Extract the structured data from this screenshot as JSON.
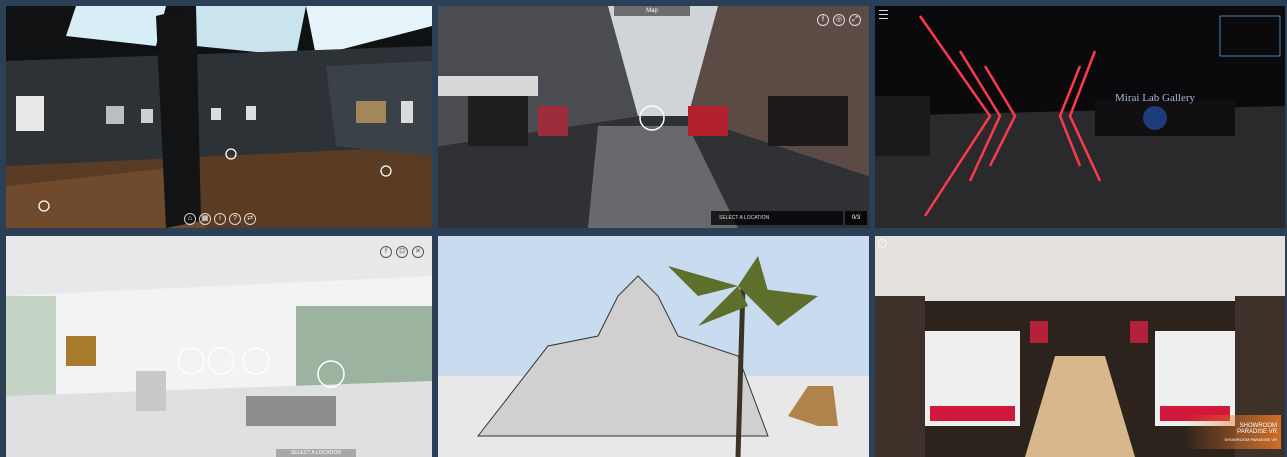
{
  "tiles": {
    "street": {
      "map_label": "Map",
      "select_location": "SELECT A LOCATION",
      "counter": "0/3",
      "social": {
        "facebook": "f",
        "instagram": "◎",
        "fullscreen": "⤢"
      }
    },
    "neon": {
      "gallery_sign": "Mirai Lab Gallery"
    },
    "white_gallery": {
      "select_location": "SELECT A LOCATION",
      "social": {
        "facebook": "f",
        "save": "⊡",
        "close": "✕"
      }
    },
    "shop": {
      "badge_line1": "SHOWROOM PARADISE VR",
      "badge_line2": "SHOWROOM PARADISE VR"
    }
  },
  "icons": {
    "home": "⌂",
    "info": "i",
    "help": "?",
    "share": "⇄",
    "gallery": "▦"
  },
  "colors": {
    "page_bg": "#2b3f56",
    "neon_red": "#ff3a4d",
    "shop_badge": "#e27a2a"
  }
}
